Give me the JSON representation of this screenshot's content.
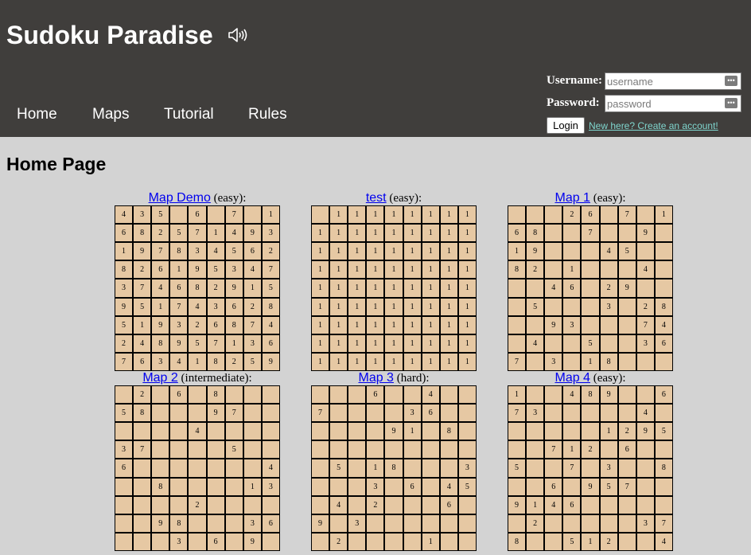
{
  "header": {
    "title": "Sudoku Paradise",
    "sound_icon": "speaker-icon",
    "nav": [
      "Home",
      "Maps",
      "Tutorial",
      "Rules"
    ]
  },
  "login": {
    "username_label": "Username:",
    "password_label": "Password:",
    "username_placeholder": "username",
    "password_placeholder": "password",
    "login_button": "Login",
    "create_account_link": "New here? Create an account!"
  },
  "colors": {
    "header_bg": "#403e3c",
    "page_bg": "#d3d3d3",
    "cell_bg": "#e6c8a3",
    "link": "#0000ee",
    "create_link": "#7fd6ce"
  },
  "page_title": "Home Page",
  "maps": [
    {
      "name": "Map Demo",
      "difficulty": "(easy):",
      "grid": [
        [
          "4",
          "3",
          "5",
          "",
          "6",
          "",
          "7",
          "",
          "1"
        ],
        [
          "6",
          "8",
          "2",
          "5",
          "7",
          "1",
          "4",
          "9",
          "3"
        ],
        [
          "1",
          "9",
          "7",
          "8",
          "3",
          "4",
          "5",
          "6",
          "2"
        ],
        [
          "8",
          "2",
          "6",
          "1",
          "9",
          "5",
          "3",
          "4",
          "7"
        ],
        [
          "3",
          "7",
          "4",
          "6",
          "8",
          "2",
          "9",
          "1",
          "5"
        ],
        [
          "9",
          "5",
          "1",
          "7",
          "4",
          "3",
          "6",
          "2",
          "8"
        ],
        [
          "5",
          "1",
          "9",
          "3",
          "2",
          "6",
          "8",
          "7",
          "4"
        ],
        [
          "2",
          "4",
          "8",
          "9",
          "5",
          "7",
          "1",
          "3",
          "6"
        ],
        [
          "7",
          "6",
          "3",
          "4",
          "1",
          "8",
          "2",
          "5",
          "9"
        ]
      ]
    },
    {
      "name": "test",
      "difficulty": "(easy):",
      "grid": [
        [
          "",
          "1",
          "1",
          "1",
          "1",
          "1",
          "1",
          "1",
          "1"
        ],
        [
          "1",
          "1",
          "1",
          "1",
          "1",
          "1",
          "1",
          "1",
          "1"
        ],
        [
          "1",
          "1",
          "1",
          "1",
          "1",
          "1",
          "1",
          "1",
          "1"
        ],
        [
          "1",
          "1",
          "1",
          "1",
          "1",
          "1",
          "1",
          "1",
          "1"
        ],
        [
          "1",
          "1",
          "1",
          "1",
          "1",
          "1",
          "1",
          "1",
          "1"
        ],
        [
          "1",
          "1",
          "1",
          "1",
          "1",
          "1",
          "1",
          "1",
          "1"
        ],
        [
          "1",
          "1",
          "1",
          "1",
          "1",
          "1",
          "1",
          "1",
          "1"
        ],
        [
          "1",
          "1",
          "1",
          "1",
          "1",
          "1",
          "1",
          "1",
          "1"
        ],
        [
          "1",
          "1",
          "1",
          "1",
          "1",
          "1",
          "1",
          "1",
          "1"
        ]
      ]
    },
    {
      "name": "Map 1",
      "difficulty": "(easy):",
      "grid": [
        [
          "",
          "",
          "",
          "2",
          "6",
          "",
          "7",
          "",
          "1"
        ],
        [
          "6",
          "8",
          "",
          "",
          "7",
          "",
          "",
          "9",
          ""
        ],
        [
          "1",
          "9",
          "",
          "",
          "",
          "4",
          "5",
          "",
          ""
        ],
        [
          "8",
          "2",
          "",
          "1",
          "",
          "",
          "",
          "4",
          ""
        ],
        [
          "",
          "",
          "4",
          "6",
          "",
          "2",
          "9",
          "",
          ""
        ],
        [
          "",
          "5",
          "",
          "",
          "",
          "3",
          "",
          "2",
          "8"
        ],
        [
          "",
          "",
          "9",
          "3",
          "",
          "",
          "",
          "7",
          "4"
        ],
        [
          "",
          "4",
          "",
          "",
          "5",
          "",
          "",
          "3",
          "6"
        ],
        [
          "7",
          "",
          "3",
          "",
          "1",
          "8",
          "",
          "",
          ""
        ]
      ]
    },
    {
      "name": "Map 2",
      "difficulty": "(intermediate):",
      "grid": [
        [
          "",
          "2",
          "",
          "6",
          "",
          "8",
          "",
          "",
          ""
        ],
        [
          "5",
          "8",
          "",
          "",
          "",
          "9",
          "7",
          "",
          ""
        ],
        [
          "",
          "",
          "",
          "",
          "4",
          "",
          "",
          "",
          ""
        ],
        [
          "3",
          "7",
          "",
          "",
          "",
          "",
          "5",
          "",
          ""
        ],
        [
          "6",
          "",
          "",
          "",
          "",
          "",
          "",
          "",
          "4"
        ],
        [
          "",
          "",
          "8",
          "",
          "",
          "",
          "",
          "1",
          "3"
        ],
        [
          "",
          "",
          "",
          "",
          "2",
          "",
          "",
          "",
          ""
        ],
        [
          "",
          "",
          "9",
          "8",
          "",
          "",
          "",
          "3",
          "6"
        ],
        [
          "",
          "",
          "",
          "3",
          "",
          "6",
          "",
          "9",
          ""
        ]
      ]
    },
    {
      "name": "Map 3",
      "difficulty": "(hard):",
      "grid": [
        [
          "",
          "",
          "",
          "6",
          "",
          "",
          "4",
          "",
          ""
        ],
        [
          "7",
          "",
          "",
          "",
          "",
          "3",
          "6",
          "",
          ""
        ],
        [
          "",
          "",
          "",
          "",
          "9",
          "1",
          "",
          "8",
          ""
        ],
        [
          "",
          "",
          "",
          "",
          "",
          "",
          "",
          "",
          ""
        ],
        [
          "",
          "5",
          "",
          "1",
          "8",
          "",
          "",
          "",
          "3"
        ],
        [
          "",
          "",
          "",
          "3",
          "",
          "6",
          "",
          "4",
          "5"
        ],
        [
          "",
          "4",
          "",
          "2",
          "",
          "",
          "",
          "6",
          ""
        ],
        [
          "9",
          "",
          "3",
          "",
          "",
          "",
          "",
          "",
          ""
        ],
        [
          "",
          "2",
          "",
          "",
          "",
          "",
          "1",
          "",
          ""
        ]
      ]
    },
    {
      "name": "Map 4",
      "difficulty": "(easy):",
      "grid": [
        [
          "1",
          "",
          "",
          "4",
          "8",
          "9",
          "",
          "",
          "6"
        ],
        [
          "7",
          "3",
          "",
          "",
          "",
          "",
          "",
          "4",
          ""
        ],
        [
          "",
          "",
          "",
          "",
          "",
          "1",
          "2",
          "9",
          "5"
        ],
        [
          "",
          "",
          "7",
          "1",
          "2",
          "",
          "6",
          "",
          ""
        ],
        [
          "5",
          "",
          "",
          "7",
          "",
          "3",
          "",
          "",
          "8"
        ],
        [
          "",
          "",
          "6",
          "",
          "9",
          "5",
          "7",
          "",
          ""
        ],
        [
          "9",
          "1",
          "4",
          "6",
          "",
          "",
          "",
          "",
          ""
        ],
        [
          "",
          "2",
          "",
          "",
          "",
          "",
          "",
          "3",
          "7"
        ],
        [
          "8",
          "",
          "",
          "5",
          "1",
          "2",
          "",
          "",
          "4"
        ]
      ]
    }
  ]
}
